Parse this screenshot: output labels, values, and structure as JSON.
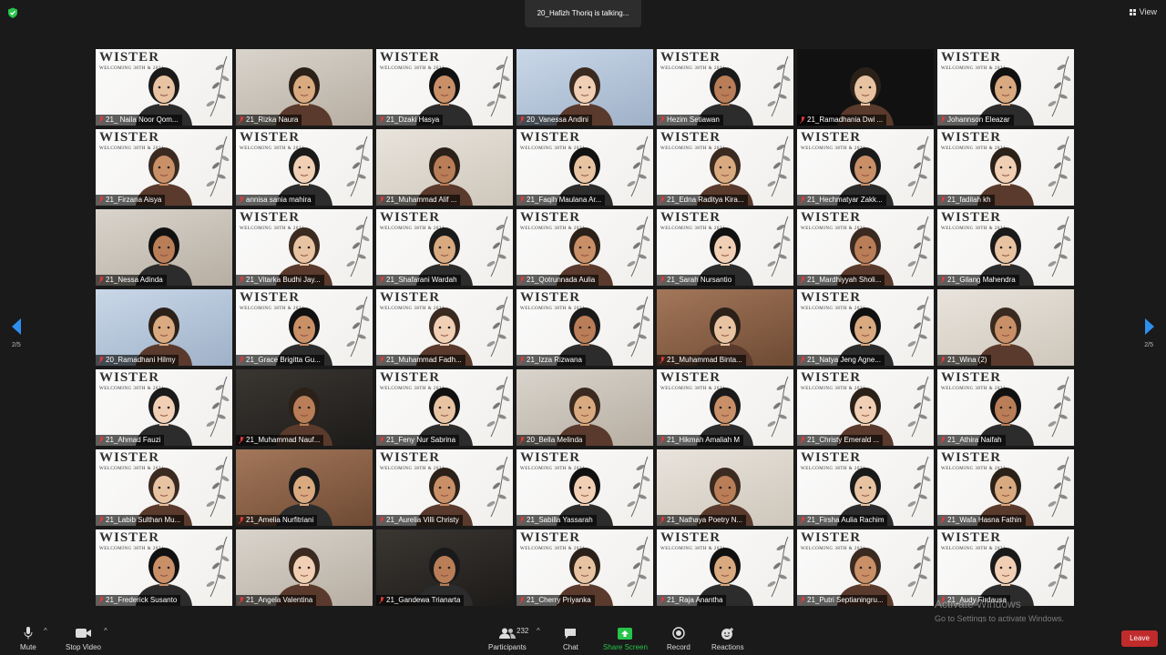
{
  "header": {
    "speaker_banner": "20_Hafizh Thoriq is talking...",
    "view_label": "View",
    "security_icon": "shield-check-icon"
  },
  "pagination": {
    "left": "2/5",
    "right": "2/5"
  },
  "participants": [
    {
      "name": "21_ Naila Noor Qom...",
      "bg": "wister"
    },
    {
      "name": "21_Rizka Naura",
      "bg": "room"
    },
    {
      "name": "21_Dzaki Hasya",
      "bg": "wister"
    },
    {
      "name": "20_Vanessa Andini",
      "bg": "blue"
    },
    {
      "name": "Hezim Setiawan",
      "bg": "wister"
    },
    {
      "name": "21_Ramadhania Dwi ...",
      "bg": "black"
    },
    {
      "name": "Johannson Eleazar",
      "bg": "wister"
    },
    {
      "name": "21_Firzana Aisya",
      "bg": "wister"
    },
    {
      "name": "annisa sania mahira",
      "bg": "wister"
    },
    {
      "name": "21_Muhammad Alif ...",
      "bg": "wall"
    },
    {
      "name": "21_Faqih Maulana Ar...",
      "bg": "wister"
    },
    {
      "name": "21_Edna Raditya Kira...",
      "bg": "wister"
    },
    {
      "name": "21_Hechmatyar Zakk...",
      "bg": "wister"
    },
    {
      "name": "21_fadilah kh",
      "bg": "wister"
    },
    {
      "name": "21_Nessa Adinda",
      "bg": "room"
    },
    {
      "name": "21_Vitarka Budhi Jay...",
      "bg": "wister"
    },
    {
      "name": "21_Shafarani Wardah",
      "bg": "wister"
    },
    {
      "name": "21_Qotrunnada Aulia",
      "bg": "wister"
    },
    {
      "name": "21_Sarah Nursantio",
      "bg": "wister"
    },
    {
      "name": "21_Mardhiyyah Sholi...",
      "bg": "wister"
    },
    {
      "name": "21_Gilang Mahendra",
      "bg": "wister"
    },
    {
      "name": "20_Ramadhani Hilmy",
      "bg": "blue"
    },
    {
      "name": "21_Grace Brigitta Gu...",
      "bg": "wister"
    },
    {
      "name": "21_Muhammad Fadh...",
      "bg": "wister"
    },
    {
      "name": "21_Izza Rizwana",
      "bg": "wister"
    },
    {
      "name": "21_Muhammad Binta...",
      "bg": "wood"
    },
    {
      "name": "21_Natya Jeng Agne...",
      "bg": "wister"
    },
    {
      "name": "21_Wina (2)",
      "bg": "wall"
    },
    {
      "name": "21_Ahmad Fauzi",
      "bg": "wister"
    },
    {
      "name": "21_Muhammad Nauf...",
      "bg": "dark"
    },
    {
      "name": "21_Feny Nur Sabrina",
      "bg": "wister"
    },
    {
      "name": "20_Bella Melinda",
      "bg": "room"
    },
    {
      "name": "21_Hikmah Amaliah M",
      "bg": "wister"
    },
    {
      "name": "21_Christy Emerald ...",
      "bg": "wister"
    },
    {
      "name": "21_Athira Naifah",
      "bg": "wister"
    },
    {
      "name": "21_Labib Sulthan Mu...",
      "bg": "wister"
    },
    {
      "name": "21_Amelia Nurfitriani",
      "bg": "wood"
    },
    {
      "name": "21_Aurelia Villi Christy",
      "bg": "wister"
    },
    {
      "name": "21_Sabilla Yassarah",
      "bg": "wister"
    },
    {
      "name": "21_Nathaya Poetry N...",
      "bg": "wall"
    },
    {
      "name": "21_Firsha Aulia Rachim",
      "bg": "wister"
    },
    {
      "name": "21_Wafa Hasna Fathin",
      "bg": "wister"
    },
    {
      "name": "21_Frederick Susanto",
      "bg": "wister"
    },
    {
      "name": "21_Angela Valentina",
      "bg": "room"
    },
    {
      "name": "21_Gandewa Trianarta",
      "bg": "dark"
    },
    {
      "name": "21_Cherry Priyanka",
      "bg": "wister"
    },
    {
      "name": "21_Raja Anantha",
      "bg": "wister"
    },
    {
      "name": "21_Putri Septianingru...",
      "bg": "wister"
    },
    {
      "name": "21_Audy Firdausa",
      "bg": "wister"
    }
  ],
  "wister": {
    "title": "WISTER",
    "subtitle": "WELCOMING 38TH & 2021"
  },
  "toolbar": {
    "mute": "Mute",
    "stop_video": "Stop Video",
    "participants": "Participants",
    "participants_count": "232",
    "chat": "Chat",
    "share_screen": "Share Screen",
    "record": "Record",
    "reactions": "Reactions",
    "leave": "Leave"
  },
  "watermark": {
    "line1": "Activate Windows",
    "line2": "Go to Settings to activate Windows."
  },
  "colors": {
    "share_green": "#27c44a",
    "leave_red": "#c02b2b",
    "arrow_blue": "#2e8ff0"
  }
}
